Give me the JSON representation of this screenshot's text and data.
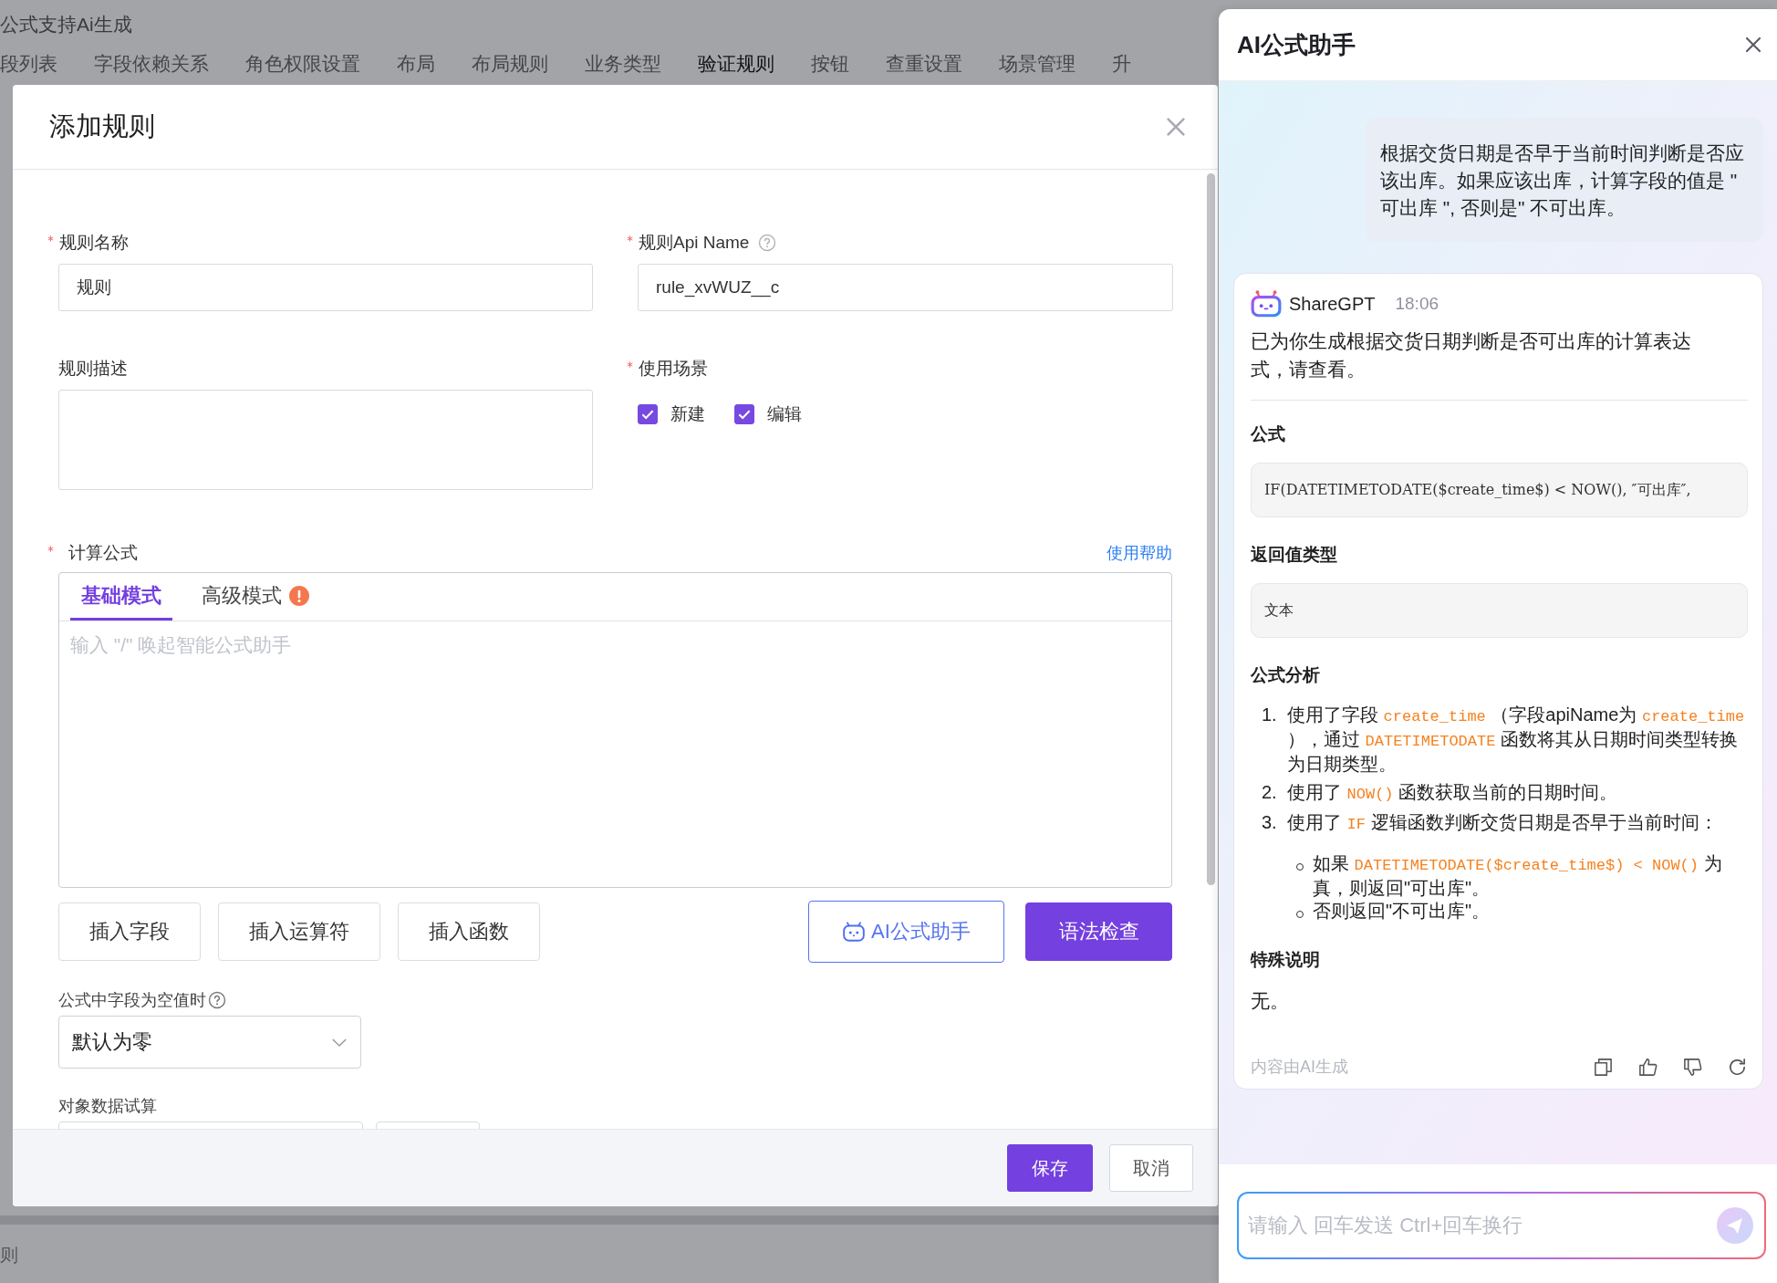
{
  "background_page": {
    "title": "公式支持Ai生成",
    "tabs": [
      {
        "label": "段列表",
        "selected": false
      },
      {
        "label": "字段依赖关系",
        "selected": false
      },
      {
        "label": "角色权限设置",
        "selected": false
      },
      {
        "label": "布局",
        "selected": false
      },
      {
        "label": "布局规则",
        "selected": false
      },
      {
        "label": "业务类型",
        "selected": false
      },
      {
        "label": "验证规则",
        "selected": true
      },
      {
        "label": "按钮",
        "selected": false
      },
      {
        "label": "查重设置",
        "selected": false
      },
      {
        "label": "场景管理",
        "selected": false
      },
      {
        "label": "升",
        "selected": false
      }
    ],
    "footer_text": "则"
  },
  "dialog": {
    "title": "添加规则",
    "rule_name": {
      "label": "规则名称",
      "required": true,
      "value": "规则"
    },
    "api_name": {
      "label": "规则Api Name",
      "required": true,
      "value": "rule_xvWUZ__c"
    },
    "description": {
      "label": "规则描述",
      "required": false
    },
    "scenarios": {
      "label": "使用场景",
      "required": true,
      "options": [
        {
          "label": "新建",
          "checked": true
        },
        {
          "label": "编辑",
          "checked": true
        }
      ]
    },
    "formula": {
      "label": "计算公式",
      "required": true,
      "help_link": "使用帮助",
      "tabs": [
        {
          "label": "基础模式",
          "selected": true,
          "warning": false
        },
        {
          "label": "高级模式",
          "selected": false,
          "warning": true
        }
      ],
      "placeholder": "输入 \"/\" 唤起智能公式助手",
      "buttons": [
        {
          "label": "插入字段",
          "kind": "plain"
        },
        {
          "label": "插入运算符",
          "kind": "plain"
        },
        {
          "label": "插入函数",
          "kind": "plain"
        },
        {
          "label": "AI公式助手",
          "kind": "ai"
        },
        {
          "label": "语法检查",
          "kind": "primary"
        }
      ]
    },
    "empty_value": {
      "label": "公式中字段为空值时",
      "value": "默认为零"
    },
    "trial": {
      "label": "对象数据试算"
    },
    "footer_buttons": [
      {
        "label": "保存",
        "kind": "primary"
      },
      {
        "label": "取消",
        "kind": "plain"
      }
    ]
  },
  "assistant": {
    "title": "AI公式助手",
    "user_message": "根据交货日期是否早于当前时间判断是否应该出库。如果应该出库，计算字段的值是 \" 可出库 \", 否则是\" 不可出库。",
    "reply": {
      "author": "ShareGPT",
      "time": "18:06",
      "intro": "已为你生成根据交货日期判断是否可出库的计算表达式，请查看。",
      "sections": [
        {
          "kind": "code",
          "heading": "公式",
          "text": "IF(DATETIMETODATE($create_time$) < NOW(), ″可出库″,"
        },
        {
          "kind": "box",
          "heading": "返回值类型",
          "text": "文本"
        },
        {
          "kind": "list",
          "heading": "公式分析",
          "items": [
            {
              "number": "1.",
              "segments": [
                {
                  "kind": "text",
                  "text": "使用了字段 "
                },
                {
                  "kind": "code",
                  "text": "create_time"
                },
                {
                  "kind": "text",
                  "text": " （字段apiName为 "
                },
                {
                  "kind": "code",
                  "text": "create_time"
                },
                {
                  "kind": "text",
                  "text": " ），通过 "
                },
                {
                  "kind": "code",
                  "text": "DATETIMETODATE"
                },
                {
                  "kind": "text",
                  "text": " 函数将其从日期时间类型转换为日期类型。"
                }
              ]
            },
            {
              "number": "2.",
              "segments": [
                {
                  "kind": "text",
                  "text": "使用了 "
                },
                {
                  "kind": "code",
                  "text": "NOW()"
                },
                {
                  "kind": "text",
                  "text": " 函数获取当前的日期时间。"
                }
              ]
            },
            {
              "number": "3.",
              "segments": [
                {
                  "kind": "text",
                  "text": "使用了 "
                },
                {
                  "kind": "code",
                  "text": "IF"
                },
                {
                  "kind": "text",
                  "text": " 逻辑函数判断交货日期是否早于当前时间："
                }
              ],
              "children": [
                {
                  "segments": [
                    {
                      "kind": "text",
                      "text": "如果 "
                    },
                    {
                      "kind": "code",
                      "text": "DATETIMETODATE($create_time$) < NOW()"
                    },
                    {
                      "kind": "text",
                      "text": " 为真，则返回\"可出库\"。"
                    }
                  ]
                },
                {
                  "segments": [
                    {
                      "kind": "text",
                      "text": "否则返回\"不可出库\"。"
                    }
                  ]
                }
              ]
            }
          ]
        },
        {
          "kind": "text",
          "heading": "特殊说明",
          "text": "无。"
        }
      ],
      "disclaimer": "内容由AI生成"
    },
    "input": {
      "placeholder": "请输入 回车发送 Ctrl+回车换行"
    }
  }
}
